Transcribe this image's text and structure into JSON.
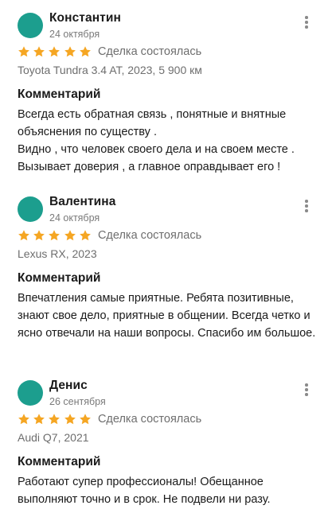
{
  "reviews": [
    {
      "author": "Константин",
      "date": "24 октября",
      "rating": 5,
      "deal_status": "Сделка состоялась",
      "car": "Toyota Tundra 3.4 AT, 2023, 5 900 км",
      "comment_title": "Комментарий",
      "comment_text": "Всегда есть обратная связь , понятные и внятные объяснения по существу .\nВидно , что человек  своего  дела и на своем месте .\nВызывает доверия , а главное оправдывает его !"
    },
    {
      "author": "Валентина",
      "date": "24 октября",
      "rating": 5,
      "deal_status": "Сделка состоялась",
      "car": "Lexus RX, 2023",
      "comment_title": "Комментарий",
      "comment_text": "Впечатления самые приятные. Ребята позитивные, знают свое дело, приятные в общении. Всегда четко и ясно отвечали на наши вопросы.  Спасибо им большое."
    },
    {
      "author": "Денис",
      "date": "26 сентября",
      "rating": 5,
      "deal_status": "Сделка состоялась",
      "car": "Audi Q7, 2021",
      "comment_title": "Комментарий",
      "comment_text": "Работают супер профессионалы! Обещанное выполняют точно и в срок. Не подвели ни разу."
    }
  ],
  "colors": {
    "avatar": "#1c9e8e",
    "star": "#f5a623",
    "muted_text": "#6e6e6e",
    "menu_dots": "#8a8a8a"
  },
  "icons": {
    "star": "star-icon",
    "menu": "more-vertical-icon"
  }
}
